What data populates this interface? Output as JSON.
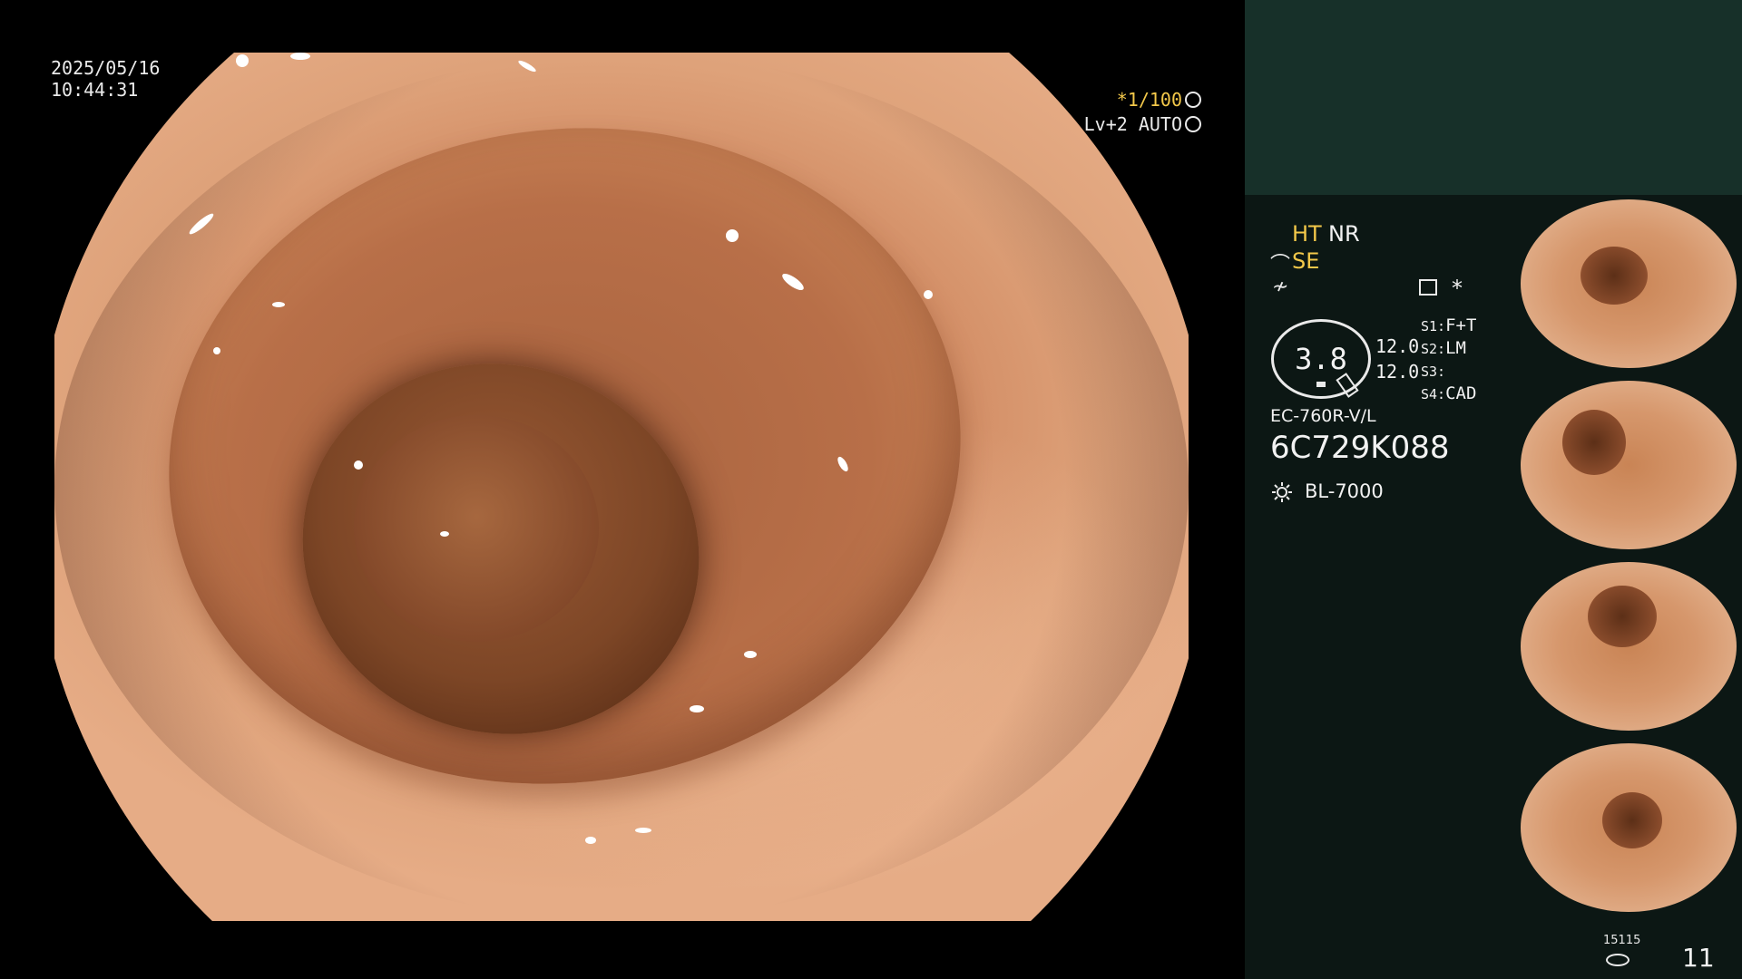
{
  "overlay": {
    "date": "2025/05/16",
    "time": "10:44:31",
    "shutter": "*1/100",
    "level": "Lv+2 AUTO"
  },
  "panel": {
    "ht": "HT",
    "nr": "NR",
    "se": "SE",
    "star": "*",
    "gauge_value": "3.8",
    "value_1": "12.0",
    "value_2": "12.0",
    "switches": [
      {
        "key": "S1:",
        "value": "F+T"
      },
      {
        "key": "S2:",
        "value": "LM"
      },
      {
        "key": "S3:",
        "value": ""
      },
      {
        "key": "S4:",
        "value": "CAD"
      }
    ],
    "scope_model": "EC-760R-V/L",
    "serial": "6C729K088",
    "light_source": "BL-7000",
    "thumbnail_count": 4,
    "capture_counter": "15115",
    "image_count": "11"
  },
  "colors": {
    "panel_bg": "#0c1714",
    "panel_top": "#173029",
    "accent_yellow": "#f3c84a",
    "text": "#f2f2f2"
  },
  "icons": [
    "gear-icon",
    "scope-icon",
    "wave-icon",
    "monitor-icon",
    "sun-icon",
    "disk-icon"
  ]
}
